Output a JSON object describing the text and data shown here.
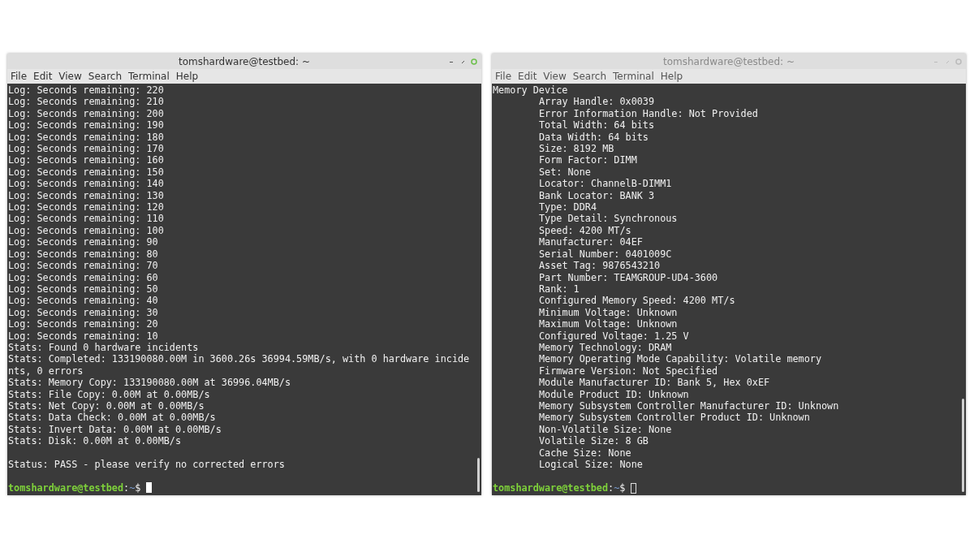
{
  "windows": [
    {
      "title": "tomshardware@testbed: ~",
      "focused": true,
      "menu": [
        "File",
        "Edit",
        "View",
        "Search",
        "Terminal",
        "Help"
      ],
      "lines": [
        {
          "text": "Log: Seconds remaining: 220"
        },
        {
          "text": "Log: Seconds remaining: 210"
        },
        {
          "text": "Log: Seconds remaining: 200"
        },
        {
          "text": "Log: Seconds remaining: 190"
        },
        {
          "text": "Log: Seconds remaining: 180"
        },
        {
          "text": "Log: Seconds remaining: 170"
        },
        {
          "text": "Log: Seconds remaining: 160"
        },
        {
          "text": "Log: Seconds remaining: 150"
        },
        {
          "text": "Log: Seconds remaining: 140"
        },
        {
          "text": "Log: Seconds remaining: 130"
        },
        {
          "text": "Log: Seconds remaining: 120"
        },
        {
          "text": "Log: Seconds remaining: 110"
        },
        {
          "text": "Log: Seconds remaining: 100"
        },
        {
          "text": "Log: Seconds remaining: 90"
        },
        {
          "text": "Log: Seconds remaining: 80"
        },
        {
          "text": "Log: Seconds remaining: 70"
        },
        {
          "text": "Log: Seconds remaining: 60"
        },
        {
          "text": "Log: Seconds remaining: 50"
        },
        {
          "text": "Log: Seconds remaining: 40"
        },
        {
          "text": "Log: Seconds remaining: 30"
        },
        {
          "text": "Log: Seconds remaining: 20"
        },
        {
          "text": "Log: Seconds remaining: 10"
        },
        {
          "text": "Stats: Found 0 hardware incidents"
        },
        {
          "text": "Stats: Completed: 133190080.00M in 3600.26s 36994.59MB/s, with 0 hardware incide"
        },
        {
          "text": "nts, 0 errors"
        },
        {
          "text": "Stats: Memory Copy: 133190080.00M at 36996.04MB/s"
        },
        {
          "text": "Stats: File Copy: 0.00M at 0.00MB/s"
        },
        {
          "text": "Stats: Net Copy: 0.00M at 0.00MB/s"
        },
        {
          "text": "Stats: Data Check: 0.00M at 0.00MB/s"
        },
        {
          "text": "Stats: Invert Data: 0.00M at 0.00MB/s"
        },
        {
          "text": "Stats: Disk: 0.00M at 0.00MB/s"
        },
        {
          "text": "Status: PASS - please verify no corrected errors",
          "gap_before": true
        }
      ],
      "prompt": {
        "user_host": "tomshardware@testbed",
        "separator": ":",
        "path": "~",
        "symbol": "$"
      }
    },
    {
      "title": "tomshardware@testbed: ~",
      "focused": false,
      "menu": [
        "File",
        "Edit",
        "View",
        "Search",
        "Terminal",
        "Help"
      ],
      "lines": [
        {
          "text": "Memory Device",
          "children": [
            "Array Handle: 0x0039",
            "Error Information Handle: Not Provided",
            "Total Width: 64 bits",
            "Data Width: 64 bits",
            "Size: 8192 MB",
            "Form Factor: DIMM",
            "Set: None",
            "Locator: ChannelB-DIMM1",
            "Bank Locator: BANK 3",
            "Type: DDR4",
            "Type Detail: Synchronous",
            "Speed: 4200 MT/s",
            "Manufacturer: 04EF",
            "Serial Number: 0401009C",
            "Asset Tag: 9876543210",
            "Part Number: TEAMGROUP-UD4-3600",
            "Rank: 1",
            "Configured Memory Speed: 4200 MT/s",
            "Minimum Voltage: Unknown",
            "Maximum Voltage: Unknown",
            "Configured Voltage: 1.25 V",
            "Memory Technology: DRAM",
            "Memory Operating Mode Capability: Volatile memory",
            "Firmware Version: Not Specified",
            "Module Manufacturer ID: Bank 5, Hex 0xEF",
            "Module Product ID: Unknown",
            "Memory Subsystem Controller Manufacturer ID: Unknown",
            "Memory Subsystem Controller Product ID: Unknown",
            "Non-Volatile Size: None",
            "Volatile Size: 8 GB",
            "Cache Size: None",
            "Logical Size: None"
          ]
        }
      ],
      "prompt": {
        "user_host": "tomshardware@testbed",
        "separator": ":",
        "path": "~",
        "symbol": "$"
      }
    }
  ]
}
